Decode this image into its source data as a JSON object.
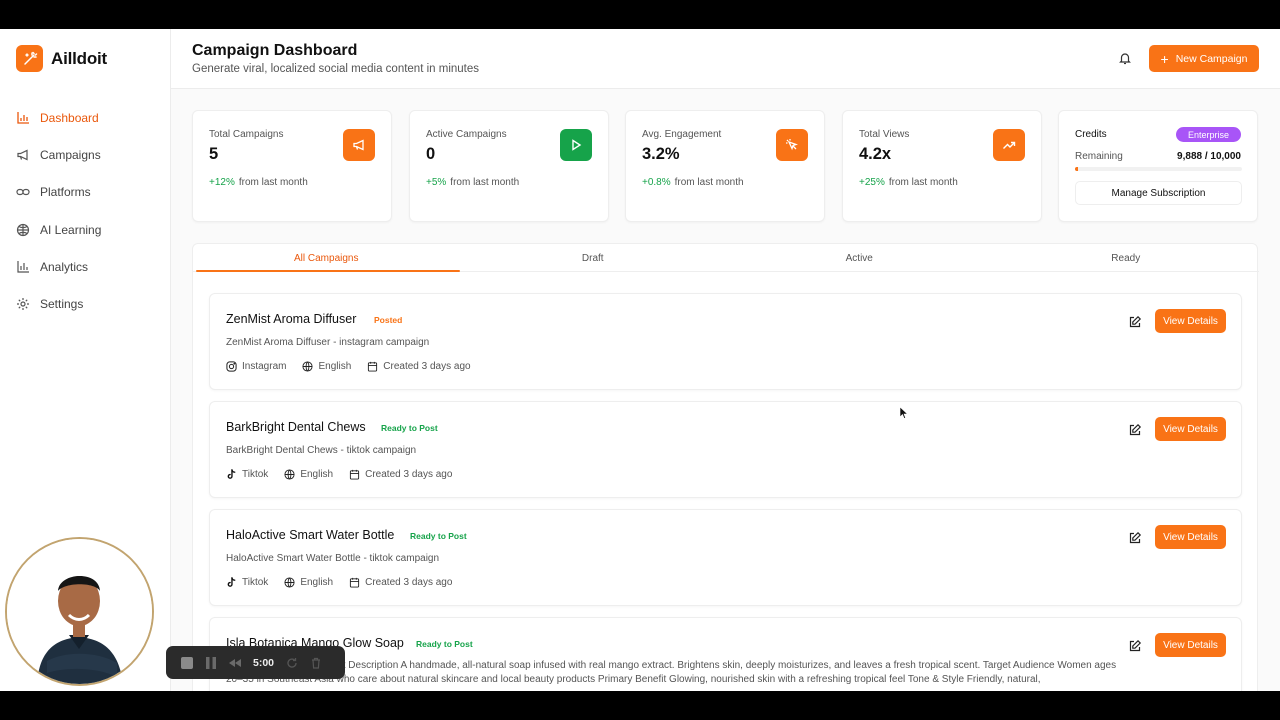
{
  "app": {
    "name": "Ailldoit"
  },
  "sidebar": {
    "items": [
      {
        "label": "Dashboard",
        "icon": "bar-chart-icon",
        "active": true
      },
      {
        "label": "Campaigns",
        "icon": "megaphone-icon"
      },
      {
        "label": "Platforms",
        "icon": "link-icon"
      },
      {
        "label": "AI Learning",
        "icon": "brain-icon"
      },
      {
        "label": "Analytics",
        "icon": "chart-icon"
      },
      {
        "label": "Settings",
        "icon": "gear-icon"
      }
    ]
  },
  "header": {
    "title": "Campaign Dashboard",
    "subtitle": "Generate viral, localized social media content in minutes",
    "new_campaign_label": "New Campaign"
  },
  "stats": [
    {
      "label": "Total Campaigns",
      "value": "5",
      "change": "+12%",
      "change_text": "from last month",
      "icon": "megaphone-icon",
      "color": "#f97316"
    },
    {
      "label": "Active Campaigns",
      "value": "0",
      "change": "+5%",
      "change_text": "from last month",
      "icon": "play-icon",
      "color": "#16a34a"
    },
    {
      "label": "Avg. Engagement",
      "value": "3.2%",
      "change": "+0.8%",
      "change_text": "from last month",
      "icon": "cursor-click-icon",
      "color": "#f97316"
    },
    {
      "label": "Total Views",
      "value": "4.2x",
      "change": "+25%",
      "change_text": "from last month",
      "icon": "trending-up-icon",
      "color": "#f97316"
    }
  ],
  "credits": {
    "title": "Credits",
    "plan": "Enterprise",
    "remaining_label": "Remaining",
    "remaining_value": "9,888 / 10,000",
    "used_fraction": 0.0112,
    "manage_label": "Manage Subscription",
    "plan_color": "#a855f7"
  },
  "tabs": [
    "All Campaigns",
    "Draft",
    "Active",
    "Ready"
  ],
  "campaigns": [
    {
      "name": "ZenMist Aroma Diffuser",
      "status": "Posted",
      "status_color": "#f97316",
      "description": "ZenMist Aroma Diffuser - instagram campaign",
      "platform": "Instagram",
      "language": "English",
      "created": "Created 3 days ago",
      "view_label": "View Details"
    },
    {
      "name": "BarkBright Dental Chews",
      "status": "Ready to Post",
      "status_color": "#16a34a",
      "description": "BarkBright Dental Chews - tiktok campaign",
      "platform": "Tiktok",
      "language": "English",
      "created": "Created 3 days ago",
      "view_label": "View Details"
    },
    {
      "name": "HaloActive Smart Water Bottle",
      "status": "Ready to Post",
      "status_color": "#16a34a",
      "description": "HaloActive Smart Water Bottle - tiktok campaign",
      "platform": "Tiktok",
      "language": "English",
      "created": "Created 3 days ago",
      "view_label": "View Details"
    },
    {
      "name": "Isla Botanica Mango Glow Soap",
      "status": "Ready to Post",
      "status_color": "#16a34a",
      "description": "Mango Glow Soap Product Description A handmade, all-natural soap infused with real mango extract. Brightens skin, deeply moisturizes, and leaves a fresh tropical scent. Target Audience Women ages 20–35 in Southeast Asia who care about natural skincare and local beauty products Primary Benefit Glowing, nourished skin with a refreshing tropical feel Tone & Style Friendly, natural,",
      "view_label": "View Details"
    }
  ],
  "recorder": {
    "time": "5:00"
  }
}
